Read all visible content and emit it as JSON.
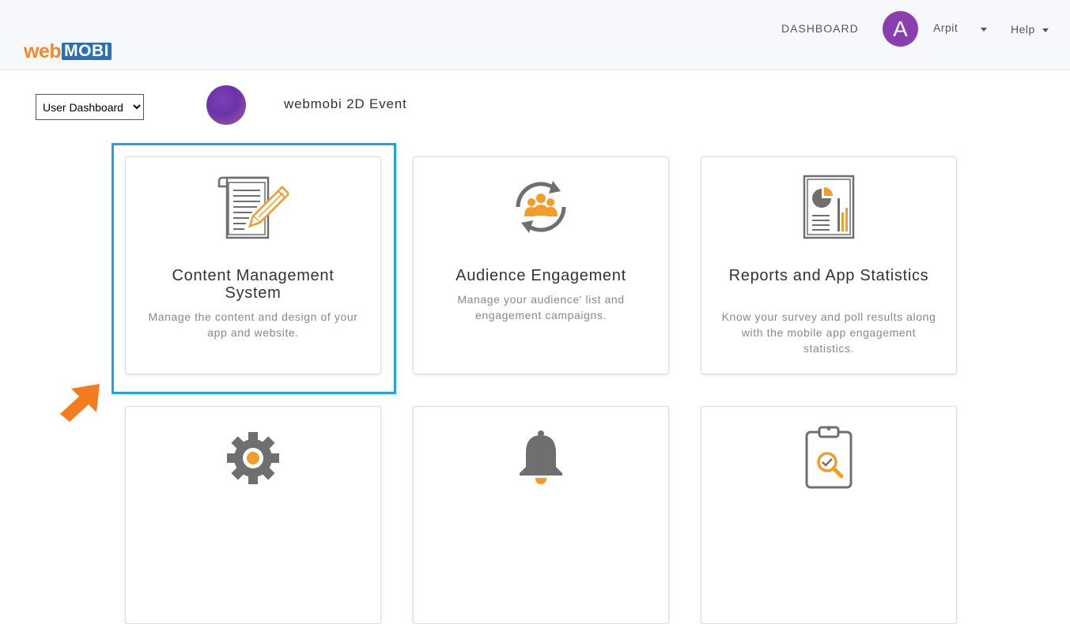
{
  "header": {
    "logo_web": "web",
    "logo_mobi": "MOBI",
    "nav_dashboard": "DASHBOARD",
    "avatar_initial": "A",
    "user_name": "Arpit",
    "help_label": "Help"
  },
  "toolbar": {
    "dashboard_select_value": "User Dashboard",
    "event_name": "webmobi 2D Event"
  },
  "cards": [
    {
      "icon": "document-pencil-icon",
      "title": "Content Management System",
      "description": "Manage the content and design of your app and website."
    },
    {
      "icon": "audience-refresh-icon",
      "title": "Audience Engagement",
      "description": "Manage your audience' list and engagement campaigns."
    },
    {
      "icon": "report-chart-icon",
      "title": "Reports and App Statistics",
      "description": "Know your survey and poll results along with the mobile app engagement statistics."
    },
    {
      "icon": "gear-icon"
    },
    {
      "icon": "bell-icon"
    },
    {
      "icon": "clipboard-search-icon"
    }
  ],
  "colors": {
    "accent_orange": "#f39c2b",
    "icon_gray": "#6f6f6f",
    "highlight_blue": "#1da4e0",
    "avatar_purple": "#8a3fb0",
    "select_border": "#8b2e9b"
  }
}
